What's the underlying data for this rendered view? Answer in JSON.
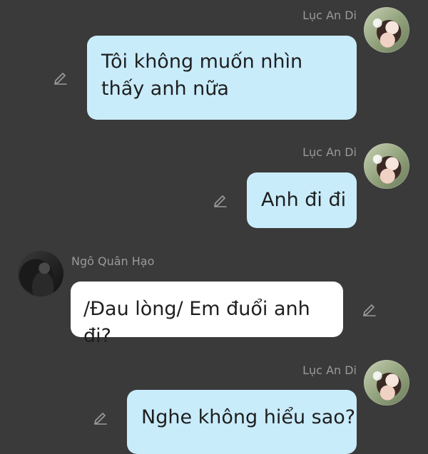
{
  "messages": [
    {
      "sender": "Lục An Di",
      "text": "Tôi không muốn nhìn thấy anh nữa",
      "bubble_color": "#c9ecfb"
    },
    {
      "sender": "Lục An Di",
      "text": "Anh đi đi",
      "bubble_color": "#c9ecfb"
    },
    {
      "sender": "Ngô Quân Hạo",
      "text": "/Đau lòng/ Em đuổi anh đi?",
      "bubble_color": "#ffffff"
    },
    {
      "sender": "Lục An Di",
      "text": "Nghe không hiểu sao?",
      "bubble_color": "#c9ecfb"
    }
  ],
  "icons": {
    "edit": "pencil-icon",
    "avatar_self": "avatar",
    "avatar_other": "avatar"
  },
  "colors": {
    "background": "#3a3a3a",
    "name_text": "#9a9a9a",
    "self_bubble": "#c9ecfb",
    "other_bubble": "#ffffff"
  }
}
